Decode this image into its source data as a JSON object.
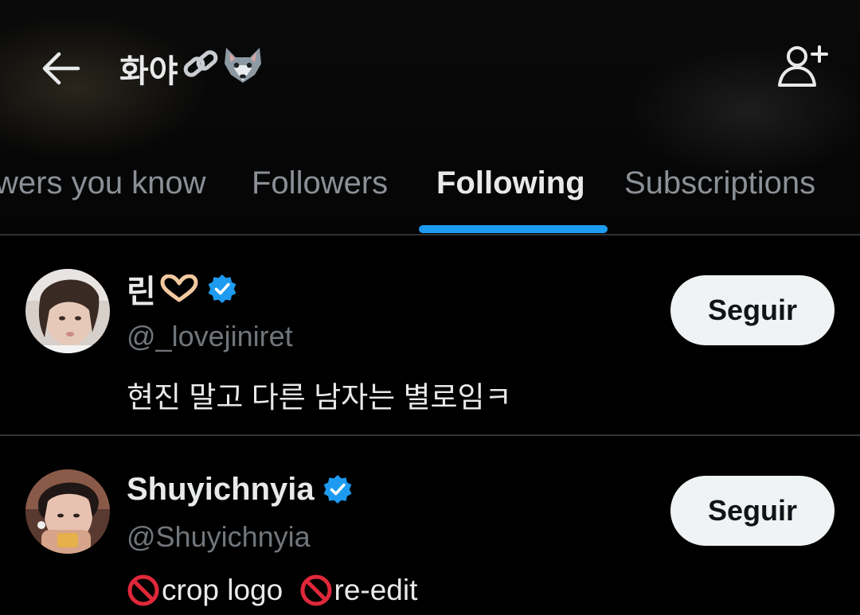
{
  "header": {
    "title": "화야🔗🐺",
    "title_text": "화야",
    "title_emoji_1": "🔗",
    "title_emoji_2": "🐺",
    "back_icon": "arrow-left-icon",
    "add_user_icon": "add-user-icon"
  },
  "tabs": [
    {
      "label": "Followers you know",
      "visible_label": "wers you know",
      "active": false
    },
    {
      "label": "Followers",
      "active": false
    },
    {
      "label": "Following",
      "active": true
    },
    {
      "label": "Subscriptions",
      "active": false
    }
  ],
  "users": [
    {
      "name": "린🫶🏻",
      "name_text": "린",
      "name_emoji": "🫶🏻",
      "verified": true,
      "handle": "@_lovejiniret",
      "bio": "현진 말고 다른 남자는 별로임ㅋ",
      "button_label": "Seguir"
    },
    {
      "name": "Shuyichnyia",
      "verified": true,
      "handle": "@Shuyichnyia",
      "bio": "🚫crop logo 🚫re-edit",
      "bio_part_1": "crop logo ",
      "bio_part_2": "re-edit",
      "button_label": "Seguir"
    }
  ],
  "colors": {
    "background": "#000000",
    "accent": "#1d9bf0",
    "text_primary": "#e7e9ea",
    "text_secondary": "#71767b",
    "tab_inactive": "#8b9096",
    "button_bg": "#eff3f4",
    "button_text": "#0f1419",
    "divider": "#2f3336"
  }
}
